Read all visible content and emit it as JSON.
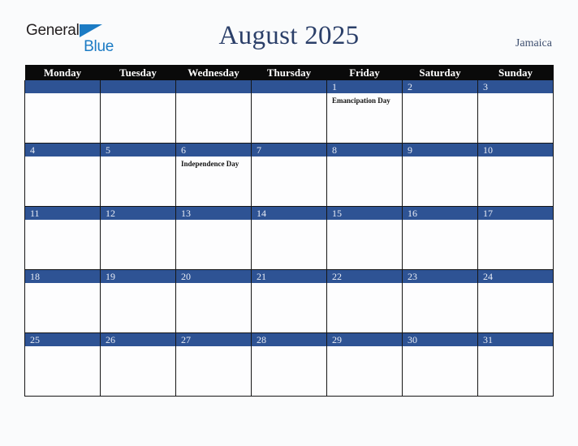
{
  "branding": {
    "logo_word_1": "General",
    "logo_word_2": "Blue",
    "logo_triangle_icon": "triangle-icon",
    "logo_color": "#1b7bc4"
  },
  "header": {
    "title": "August 2025",
    "month": "August",
    "year": "2025",
    "country": "Jamaica",
    "title_color": "#2b3f69"
  },
  "colors": {
    "day_bar_blue": "#2e5394",
    "header_black": "#0a0a0a",
    "page_background": "#fafbfc",
    "cell_background": "#fdfdfe",
    "grid_line": "#161616"
  },
  "weekdays": [
    "Monday",
    "Tuesday",
    "Wednesday",
    "Thursday",
    "Friday",
    "Saturday",
    "Sunday"
  ],
  "weeks": [
    [
      {
        "day": "",
        "event": ""
      },
      {
        "day": "",
        "event": ""
      },
      {
        "day": "",
        "event": ""
      },
      {
        "day": "",
        "event": ""
      },
      {
        "day": "1",
        "event": "Emancipation Day"
      },
      {
        "day": "2",
        "event": ""
      },
      {
        "day": "3",
        "event": ""
      }
    ],
    [
      {
        "day": "4",
        "event": ""
      },
      {
        "day": "5",
        "event": ""
      },
      {
        "day": "6",
        "event": "Independence Day"
      },
      {
        "day": "7",
        "event": ""
      },
      {
        "day": "8",
        "event": ""
      },
      {
        "day": "9",
        "event": ""
      },
      {
        "day": "10",
        "event": ""
      }
    ],
    [
      {
        "day": "11",
        "event": ""
      },
      {
        "day": "12",
        "event": ""
      },
      {
        "day": "13",
        "event": ""
      },
      {
        "day": "14",
        "event": ""
      },
      {
        "day": "15",
        "event": ""
      },
      {
        "day": "16",
        "event": ""
      },
      {
        "day": "17",
        "event": ""
      }
    ],
    [
      {
        "day": "18",
        "event": ""
      },
      {
        "day": "19",
        "event": ""
      },
      {
        "day": "20",
        "event": ""
      },
      {
        "day": "21",
        "event": ""
      },
      {
        "day": "22",
        "event": ""
      },
      {
        "day": "23",
        "event": ""
      },
      {
        "day": "24",
        "event": ""
      }
    ],
    [
      {
        "day": "25",
        "event": ""
      },
      {
        "day": "26",
        "event": ""
      },
      {
        "day": "27",
        "event": ""
      },
      {
        "day": "28",
        "event": ""
      },
      {
        "day": "29",
        "event": ""
      },
      {
        "day": "30",
        "event": ""
      },
      {
        "day": "31",
        "event": ""
      }
    ]
  ],
  "holidays": [
    {
      "date": "1",
      "name": "Emancipation Day"
    },
    {
      "date": "6",
      "name": "Independence Day"
    }
  ]
}
